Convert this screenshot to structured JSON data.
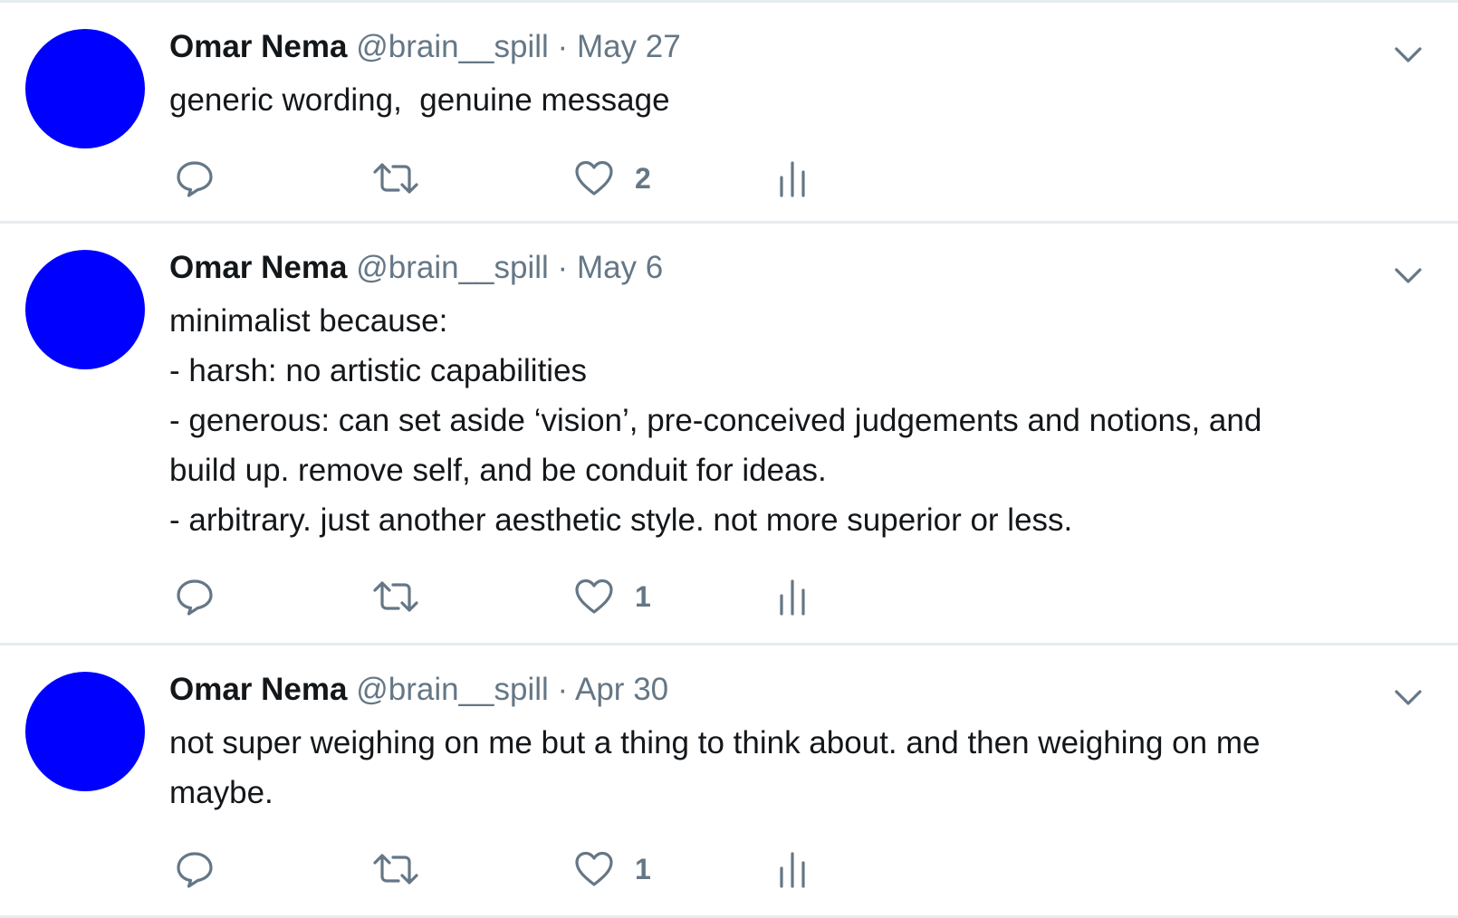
{
  "tweets": [
    {
      "author": {
        "name": "Omar Nema",
        "handle": "@brain__spill"
      },
      "separator": "·",
      "date": "May 27",
      "text": "generic wording,  genuine message",
      "likes": "2"
    },
    {
      "author": {
        "name": "Omar Nema",
        "handle": "@brain__spill"
      },
      "separator": "·",
      "date": "May 6",
      "text": "minimalist because:\n- harsh: no artistic capabilities\n- generous: can set aside ‘vision’, pre-conceived judgements and notions, and\nbuild up. remove self, and be conduit for ideas.\n- arbitrary. just another aesthetic style. not more superior or less.",
      "likes": "1"
    },
    {
      "author": {
        "name": "Omar Nema",
        "handle": "@brain__spill"
      },
      "separator": "·",
      "date": "Apr 30",
      "text": "not super weighing on me but a thing to think about. and then weighing on me\nmaybe.",
      "likes": "1"
    }
  ],
  "colors": {
    "avatar": "#0000ff",
    "secondary_text": "#657786",
    "divider": "#e6ecf0"
  },
  "icons": [
    "chevron-down-icon",
    "reply-icon",
    "retweet-icon",
    "heart-icon",
    "analytics-icon"
  ]
}
